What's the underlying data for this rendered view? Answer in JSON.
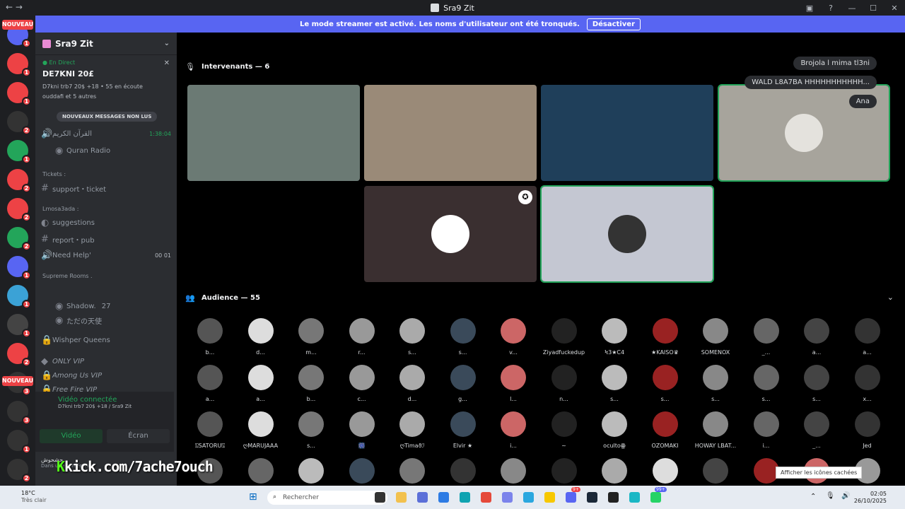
{
  "window": {
    "title": "Sra9 Zit"
  },
  "banner": {
    "text": "Le mode streamer est activé. Les noms d'utilisateur ont été tronqués.",
    "button": "Désactiver"
  },
  "guild_badges": [
    "1",
    "1",
    "1",
    "2",
    "1",
    "2",
    "2",
    "2",
    "1",
    "1",
    "1",
    "2",
    "3",
    "3",
    "1",
    "2",
    "1"
  ],
  "nouveau": "NOUVEAU",
  "server": {
    "name": "Sra9 Zit"
  },
  "live": {
    "status": "En Direct",
    "title": "DE7KNI 20£",
    "sub": "D7kni trb7 20$ +18 • 55 en écoute",
    "watchers": "ouddafi et 5 autres"
  },
  "unread_chip": "NOUVEAUX MESSAGES NON LUS",
  "channels": {
    "quran_voice": "القرآن الكريم",
    "quran_time": "1:38:04",
    "quran_radio": "Quran Radio",
    "tickets_cat": "Tickets :",
    "support": "support・ticket",
    "lmosa_cat": "Lmosa3ada :",
    "suggestions": "suggestions",
    "report": "report・pub",
    "help": "Need Help'",
    "help_a": "00",
    "help_b": "01",
    "supreme_cat": "Supreme Rooms .",
    "shadow": "Shadow.",
    "shadow_count": "27",
    "tenshi": "ただの天使",
    "wishper": "Wishper Queens",
    "onlyvip": "ONLY VIP",
    "amongus": "Among Us VIP",
    "freefire": "Free Fire VIP"
  },
  "voice": {
    "status": "Vidéo connectée",
    "sub": "D7kni trb7 20$ +18 / Sra9 Zit",
    "video": "Vidéo",
    "screen": "Écran"
  },
  "user": {
    "name": "حشحوش",
    "status": "Dans une conférence"
  },
  "overlay": {
    "kick_k": "K",
    "kick_text": "kick.com/7ache7ouch"
  },
  "stage": {
    "speakers_title": "Intervenants — 6",
    "audience_title": "Audience — 55"
  },
  "chat_bubbles": [
    "Brojola l mima tl3ni",
    "WALD L8A7BA HHHHHHHHHHH...",
    "Ana"
  ],
  "audience": [
    "b...",
    "d...",
    "m...",
    "r...",
    "s...",
    "s...",
    "v...",
    "Ziyadfuckedup",
    "Ϟ3★C4",
    "★KAISO♛",
    "SOMENOX",
    "_...",
    "a...",
    "a...",
    "a...",
    "a...",
    "b...",
    "c...",
    "d...",
    "g...",
    "l...",
    "n...",
    "s...",
    "s...",
    "s...",
    "s...",
    "s...",
    "x...",
    "⍂SATORU⍂",
    "ღMARUJAAA",
    "s...",
    "🎆",
    "ღTimaϑℐ",
    "Elvir ★",
    "i...",
    "~",
    "ocultoꙮ",
    "OZOMAKI",
    "HOWAY LBAT...",
    "i...",
    "_...",
    "Jed"
  ],
  "taskbar": {
    "temp": "18°C",
    "weather": "Très clair",
    "search": "Rechercher",
    "time": "02:05",
    "date": "26/10/2025",
    "badge_a": "9+",
    "badge_b": "99+"
  },
  "tooltip": "Afficher les icônes cachées",
  "colors": {
    "blurple": "#5865f2",
    "green": "#23a55a",
    "red": "#ed4245",
    "kick": "#53fc18"
  }
}
